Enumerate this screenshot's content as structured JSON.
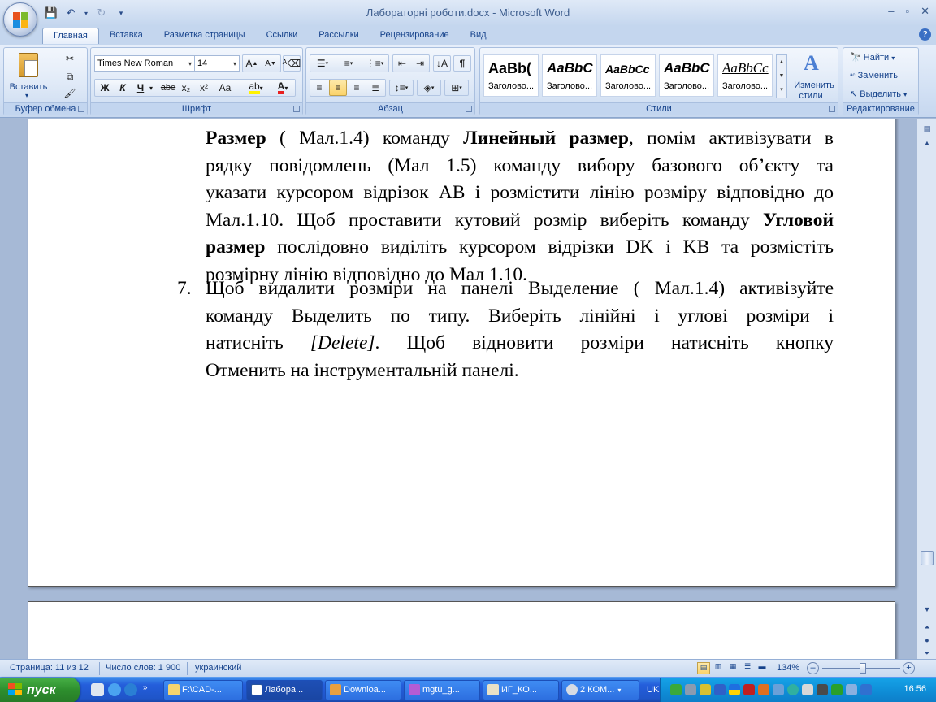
{
  "window": {
    "title": "Лабораторні роботи.docx - Microsoft Word"
  },
  "tabs": [
    "Главная",
    "Вставка",
    "Разметка страницы",
    "Ссылки",
    "Рассылки",
    "Рецензирование",
    "Вид"
  ],
  "ribbon": {
    "clipboard": {
      "label": "Буфер обмена",
      "paste": "Вставить"
    },
    "font": {
      "label": "Шрифт",
      "name": "Times New Roman",
      "size": "14",
      "bold": "Ж",
      "italic": "К",
      "underline": "Ч",
      "strike": "abe",
      "sub": "x₂",
      "sup": "x²",
      "case": "Aa"
    },
    "paragraph": {
      "label": "Абзац"
    },
    "styles": {
      "label": "Стили",
      "items": [
        {
          "sample": "AaBb(",
          "name": "Заголово..."
        },
        {
          "sample": "AaBbC",
          "name": "Заголово..."
        },
        {
          "sample": "AaBbCc",
          "name": "Заголово..."
        },
        {
          "sample": "AaBbC",
          "name": "Заголово..."
        },
        {
          "sample": "AaBbCc",
          "name": "Заголово..."
        }
      ],
      "change_line1": "Изменить",
      "change_line2": "стили"
    },
    "editing": {
      "label": "Редактирование",
      "find": "Найти",
      "replace": "Заменить",
      "select": "Выделить"
    }
  },
  "document": {
    "para1": {
      "l1": {
        "b1": "Размер",
        "t1": " ( Мал.1.4) команду ",
        "b2": "Линейный размер",
        "t2": ", помім активізувати в"
      },
      "l2": "рядку повідомлень (Мал 1.5) команду вибору базового об’єкту та",
      "l3": "указати курсором відрізок АВ і розмістити лінію розміру відповідно до",
      "l4": {
        "t1": "Мал.1.10. Щоб проставити кутовий розмір виберіть команду ",
        "b1": "Угловой"
      },
      "l5": {
        "b1": "размер",
        "t1": " послідовно виділіть курсором відрізки DK і  KB та розмістіть"
      },
      "l6": "розмірну лінію відповідно до Мал 1.10."
    },
    "para2": {
      "num": "7.",
      "l1": "Щоб видалити розміри на панелі Выделение ( Мал.1.4) активізуйте",
      "l2": "команду  Выделить по типу. Виберіть лінійні і углові розміри і",
      "l3": {
        "t1": "натисніть ",
        "i1": "[Delete]",
        "t2": ". Щоб відновити розміри натисніть кнопку"
      },
      "l4": "Отменить на інструментальній панелі."
    }
  },
  "status": {
    "page": "Страница: 11 из 12",
    "words": "Число слов: 1 900",
    "lang": "украинский",
    "zoom": "134%"
  },
  "taskbar": {
    "start": "пуск",
    "buttons": [
      "F:\\CAD-...",
      "Лабора...",
      "Downloa...",
      "mgtu_g...",
      "ИГ_КО...",
      "2 КОМ..."
    ],
    "lang": "UK",
    "time": "16:56"
  }
}
